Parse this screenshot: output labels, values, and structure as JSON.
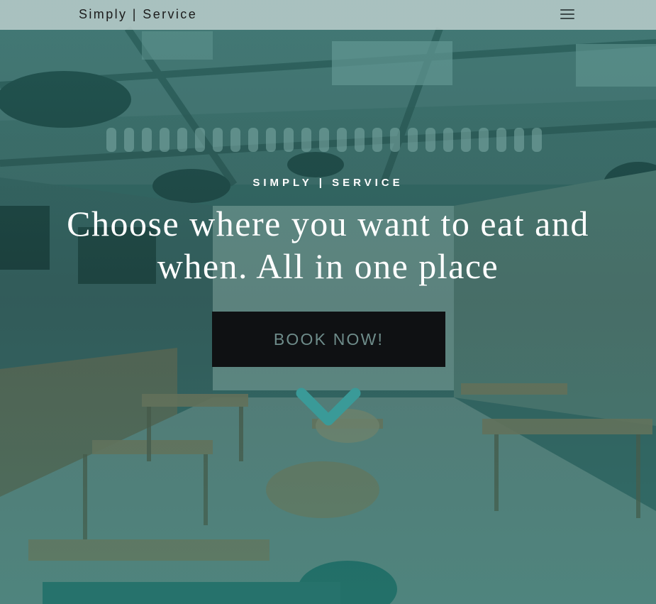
{
  "navbar": {
    "brand": "Simply | Service",
    "menu_icon": "hamburger-menu-icon"
  },
  "hero": {
    "kicker": "SIMPLY | SERVICE",
    "headline_line1": "Choose where you want to eat and",
    "headline_line2": "when. All in one place",
    "cta_label": "BOOK NOW!",
    "scroll_icon": "chevron-down-icon",
    "background_image": "cafe-interior-photo"
  },
  "colors": {
    "overlay_teal": "#2a9a90",
    "navbar_bg": "#c8d7d6",
    "cta_bg": "#0f1113",
    "cta_text": "#6e8c8a",
    "chevron": "#3a9a98"
  }
}
